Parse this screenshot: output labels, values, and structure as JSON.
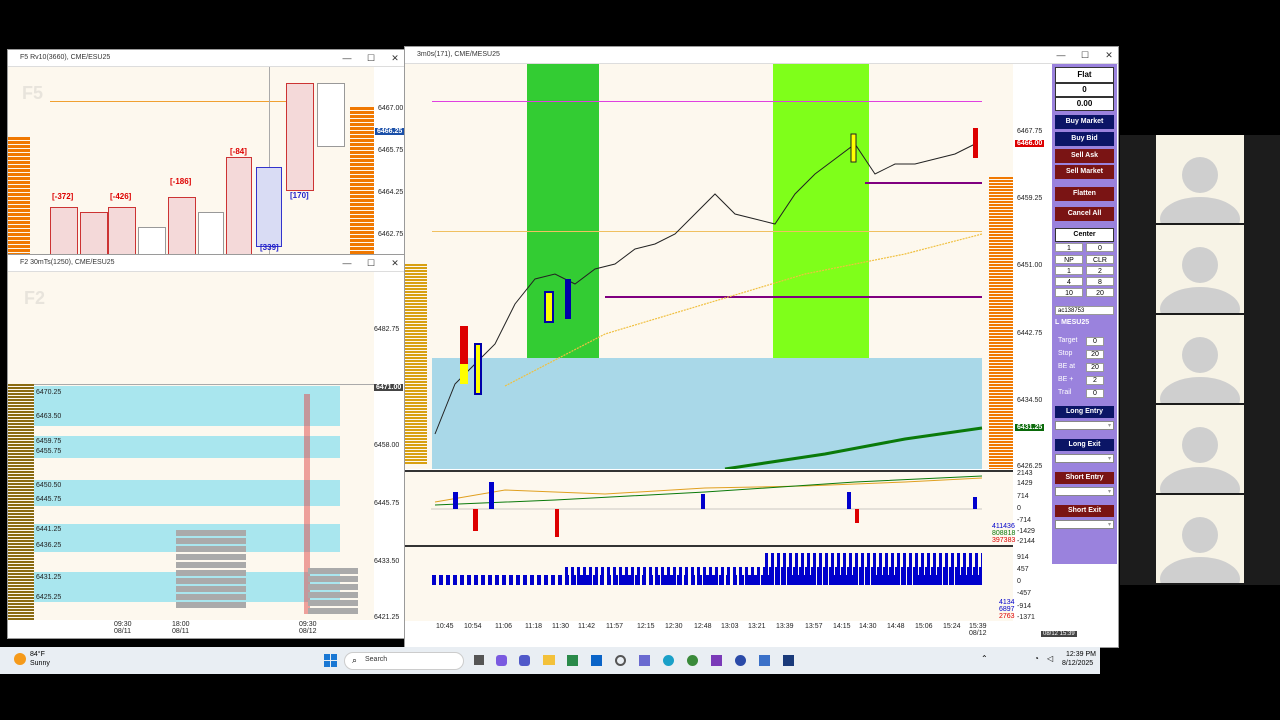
{
  "f5_window": {
    "title": "F5 Rv10(3660), CME/ESU25",
    "pane_label": "F5",
    "prices": [
      "6467.00",
      "6465.75",
      "6464.25",
      "6462.75"
    ],
    "current_price": "6466.25",
    "delta_labels": [
      "[-372]",
      "[-426]",
      "[-186]",
      "[-84]",
      "[170]",
      "[339]"
    ]
  },
  "f2_window": {
    "title": "F2 30mTs(1250), CME/ESU25",
    "pane_label": "F2",
    "prices": [
      "6482.75",
      "6458.00",
      "6445.75",
      "6433.50",
      "6421.25"
    ],
    "current_price": "6471.00",
    "profile_levels": [
      "6470.25",
      "6463.50",
      "6459.75",
      "6455.75",
      "6450.50",
      "6445.75",
      "6441.25",
      "6436.25",
      "6431.25",
      "6425.25"
    ],
    "time_labels": [
      {
        "time": "09:30",
        "date": "08/11"
      },
      {
        "time": "18:00",
        "date": "08/11"
      },
      {
        "time": "09:30",
        "date": "08/12"
      }
    ]
  },
  "main_window": {
    "title": "3m0s(171), CME/MESU25",
    "prices": [
      "6467.75",
      "6459.25",
      "6451.00",
      "6442.75",
      "6434.50",
      "6426.25"
    ],
    "current_price": "6466.00",
    "lower_tag": "6431.25",
    "delta_axis": [
      "2143",
      "1429",
      "714",
      "0",
      "-714",
      "-1429",
      "-2144"
    ],
    "delta_readouts": [
      "411436",
      "808818",
      "397383"
    ],
    "volume_axis": [
      "914",
      "457",
      "0",
      "-457",
      "-914",
      "-1371"
    ],
    "volume_readouts": [
      "4134",
      "6897",
      "2763"
    ],
    "time_labels": [
      "10:45",
      "10:54",
      "11:06",
      "11:18",
      "11:30",
      "11:42",
      "11:57",
      "12:15",
      "12:30",
      "12:48",
      "13:03",
      "13:21",
      "13:39",
      "13:57",
      "14:15",
      "14:30",
      "14:48",
      "15:06",
      "15:24",
      "15:39"
    ],
    "last_date": "08/12",
    "clock_readout": "08/12 15:39"
  },
  "order_panel": {
    "status": "Flat",
    "position": "0",
    "pnl": "0.00",
    "buy_market": "Buy Market",
    "buy_bid": "Buy Bid",
    "sell_ask": "Sell Ask",
    "sell_market": "Sell Market",
    "flatten": "Flatten",
    "cancel_all": "Cancel All",
    "center": "Center",
    "qty": "1",
    "qty2": "0",
    "grid": [
      "NP",
      "CLR",
      "1",
      "2",
      "4",
      "8",
      "10",
      "20"
    ],
    "account": "ac138753",
    "symbol": "L MESU25",
    "target_label": "Target",
    "target_value": "0",
    "stop_label": "Stop",
    "stop_value": "20",
    "beat_label": "BE at",
    "beat_value": "20",
    "beplus_label": "BE +",
    "beplus_value": "2",
    "trail_label": "Trail",
    "trail_value": "0",
    "long_entry": "Long Entry",
    "long_exit": "Long Exit",
    "short_entry": "Short Entry",
    "short_exit": "Short Exit"
  },
  "taskbar": {
    "weather_temp": "84°F",
    "weather_desc": "Sunny",
    "search_placeholder": "Search",
    "time": "12:39 PM",
    "date": "8/12/2025"
  },
  "colors": {
    "navy_button": "#0b1566",
    "maroon_button": "#7a1414",
    "panel_purple": "#9a82dd",
    "green_zone": "#33cc33",
    "lime_zone": "#7fff1a",
    "blue_zone": "#a9d8e8"
  }
}
